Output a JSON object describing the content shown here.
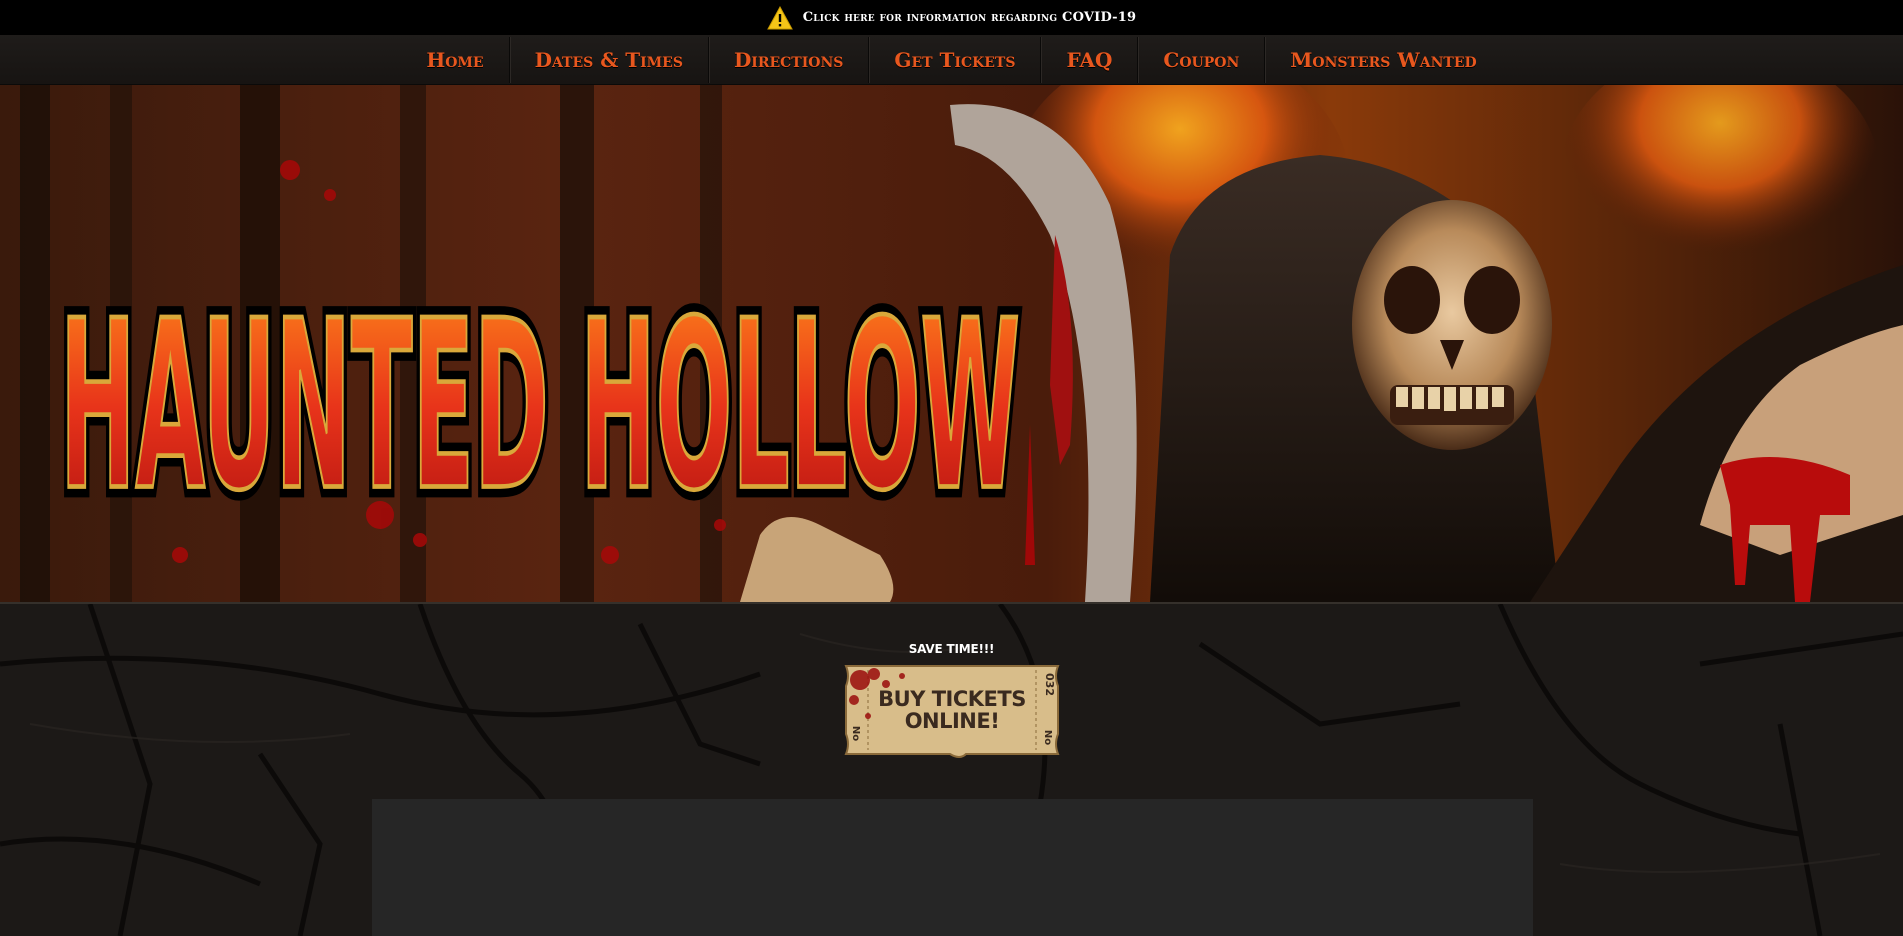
{
  "alert": {
    "icon": "warning-icon",
    "text": "Click here for information regarding COVID-19",
    "icon_color": "#f5c518"
  },
  "nav": {
    "items": [
      {
        "label": "Home"
      },
      {
        "label": "Dates & Times"
      },
      {
        "label": "Directions"
      },
      {
        "label": "Get Tickets"
      },
      {
        "label": "FAQ"
      },
      {
        "label": "Coupon"
      },
      {
        "label": "Monsters Wanted"
      }
    ],
    "link_color": "#e8571e"
  },
  "hero": {
    "logo_text": "HAUNTED HOLLOW"
  },
  "tickets": {
    "caption": "SAVE TIME!!!",
    "button_line1": "BUY TICKETS",
    "button_line2": "ONLINE!",
    "stub_no": "No",
    "stub_number": "032"
  },
  "colors": {
    "background": "#151311",
    "panel": "#262626",
    "accent": "#e8571e"
  }
}
